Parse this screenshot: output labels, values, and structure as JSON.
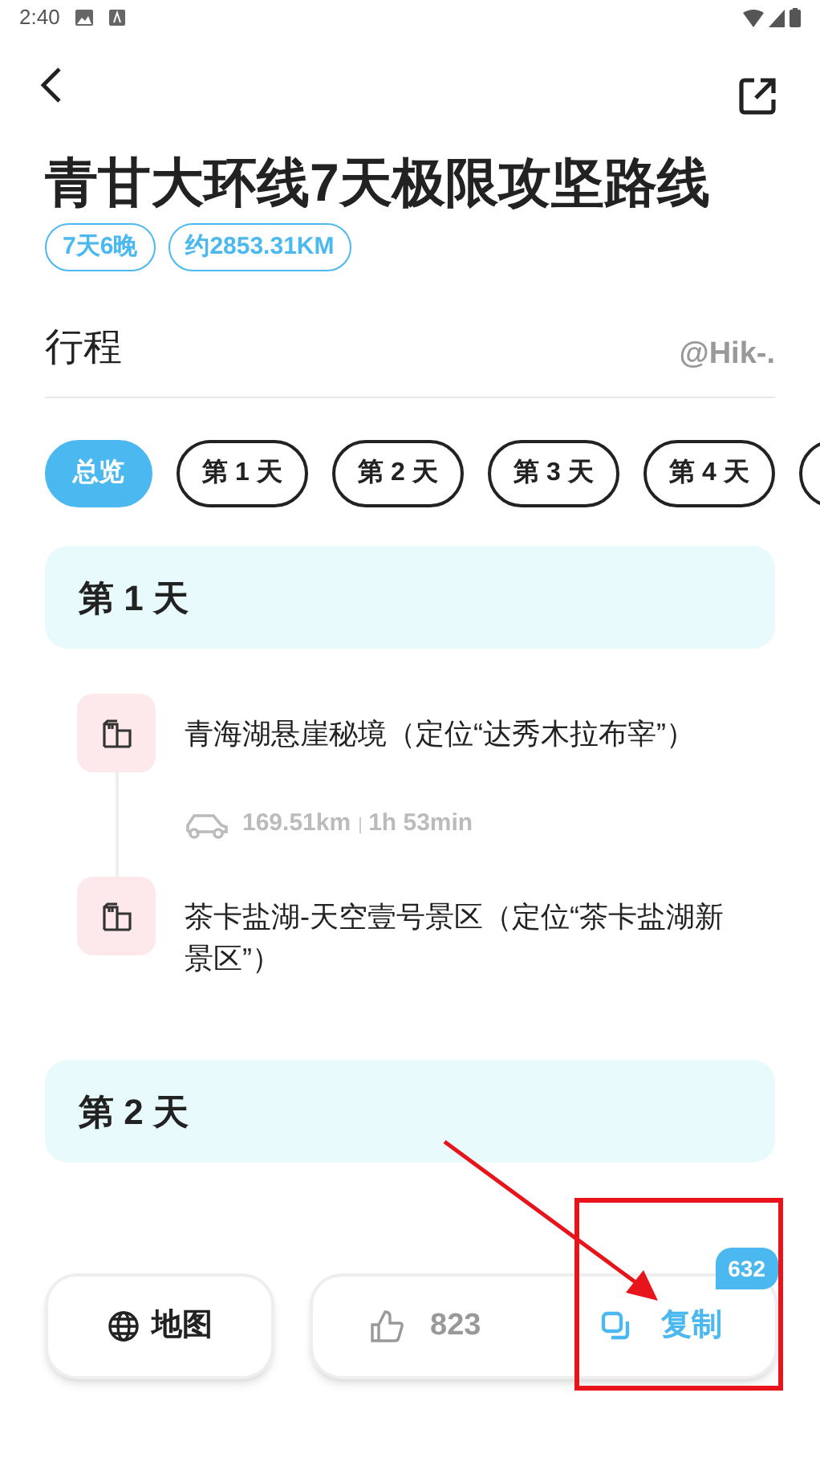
{
  "status_bar": {
    "time": "2:40"
  },
  "title": "青甘大环线7天极限攻坚路线",
  "tags": [
    "7天6晚",
    "约2853.31KM"
  ],
  "section": {
    "title": "行程",
    "author": "@Hik-."
  },
  "tabs": [
    {
      "label": "总览",
      "selected": true
    },
    {
      "label": "第 1 天",
      "selected": false
    },
    {
      "label": "第 2 天",
      "selected": false
    },
    {
      "label": "第 3 天",
      "selected": false
    },
    {
      "label": "第 4 天",
      "selected": false
    },
    {
      "selected": false
    }
  ],
  "days": [
    {
      "title": "第 1 天",
      "stops": [
        {
          "name": "青海湖悬崖秘境（定位“达秀木拉布宰”）"
        },
        {
          "name": "茶卡盐湖-天空壹号景区（定位“茶卡盐湖新景区”）"
        }
      ],
      "legs": [
        {
          "distance": "169.51km",
          "duration": "1h 53min"
        }
      ]
    },
    {
      "title": "第 2 天"
    }
  ],
  "bottom_bar": {
    "map": "地图",
    "likes": "823",
    "copy": "复制",
    "copy_count": "632"
  }
}
